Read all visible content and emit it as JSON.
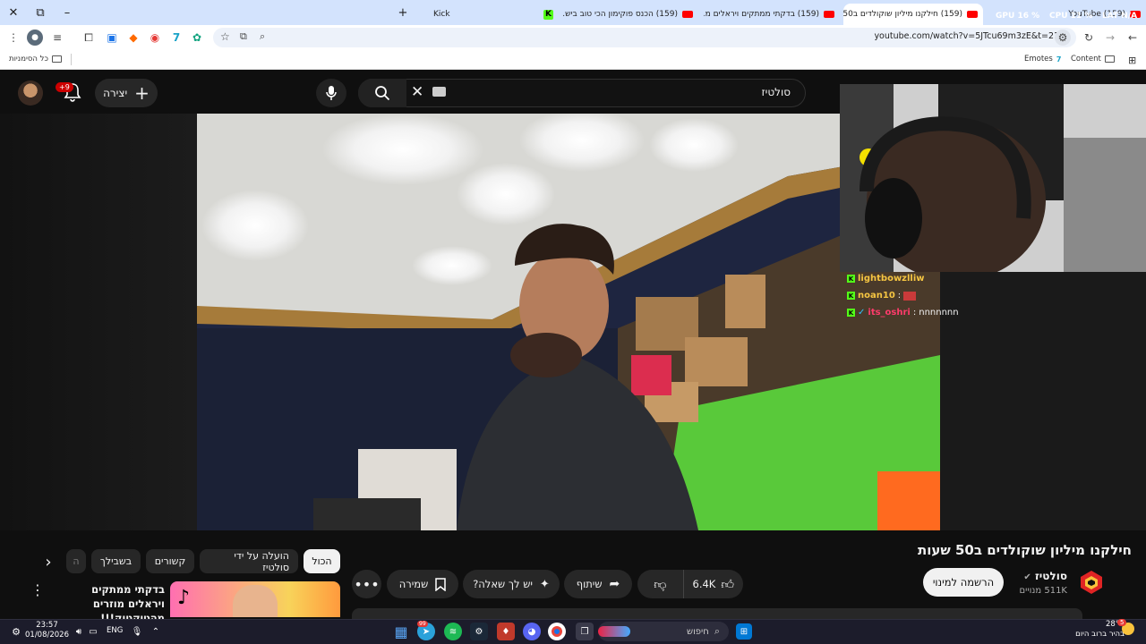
{
  "browser": {
    "tabs": [
      {
        "label": "(159) YouTube",
        "type": "youtube"
      },
      {
        "label": "(159) חילקנו מיליון שוקולדים ב50...",
        "type": "youtube",
        "active": true
      },
      {
        "label": "(159) בדקתי ממתקים ויראלים מ...",
        "type": "youtube"
      },
      {
        "label": "(159) הכנס פוקימון הכי טוב ביש...",
        "type": "youtube"
      },
      {
        "label": "Kick",
        "type": "kick"
      }
    ],
    "overlay": {
      "gpu_label": "GPU",
      "gpu_value": "16 %",
      "cpu_label": "CPU",
      "cpu_value": "11 %",
      "lat_label": "LAT",
      "lat_value": "N/A"
    },
    "new_tab": "+",
    "url": "youtube.com/watch?v=5JTcu69m3zE&t=21s",
    "bookmarks": {
      "all": "כל הסימניות",
      "emotes": "Emotes",
      "content": "Content"
    }
  },
  "youtube": {
    "search_value": "סולטיז",
    "create_label": "יצירה",
    "notifications_badge": "+9",
    "video": {
      "title": "חילקנו מיליון שוקולדים ב50 שעות",
      "channel_name": "סולטיז",
      "subscribers": "511K מנויים",
      "subscribe_label": "הרשמה למינוי",
      "likes": "6.4K",
      "share_label": "שיתוף",
      "ask_label": "יש לך שאלה?",
      "save_label": "שמירה"
    },
    "chat": [
      {
        "user": "lightbowzlliw",
        "message": ""
      },
      {
        "user": "noan10",
        "message": ""
      },
      {
        "user": "its_oshri",
        "message": "nnnnnnn"
      }
    ],
    "chips": [
      {
        "label": "הכול",
        "selected": true
      },
      {
        "label": "הועלה על ידי סולטיז"
      },
      {
        "label": "קשורים"
      },
      {
        "label": "בשבילך"
      },
      {
        "label": "ה"
      }
    ],
    "related": {
      "title": "בדקתי ממתקים ויראלים מוזרים מהטיקטוק!!!"
    }
  },
  "taskbar": {
    "search_placeholder": "חיפוש",
    "time": "23:57",
    "date": "01/08/2026",
    "language": "ENG",
    "weather_temp": "28°C",
    "weather_desc": "בהיר ברוב היום",
    "telegram_badge": "99",
    "weather_badge": "5"
  }
}
